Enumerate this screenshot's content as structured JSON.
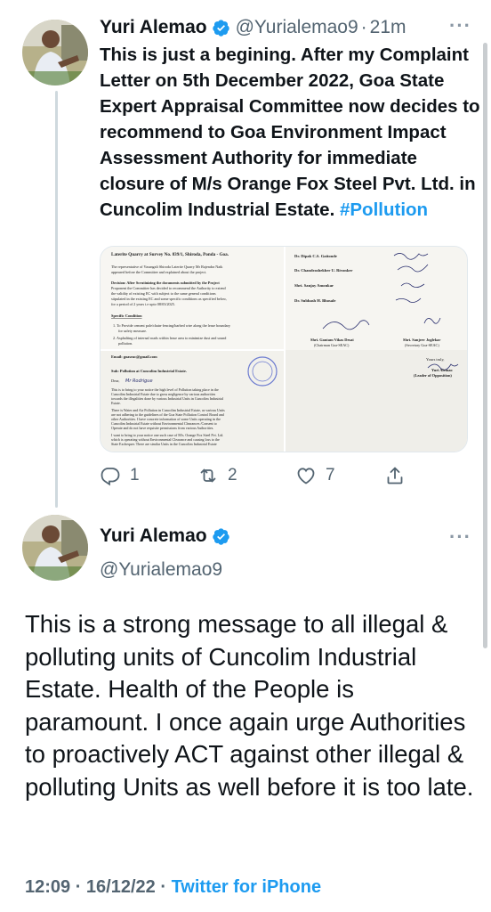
{
  "tweet1": {
    "author_name": "Yuri Alemao",
    "author_handle": "@Yurialemao9",
    "time_ago": "21m",
    "text": "This is just a begining. After my Complaint Letter on 5th December 2022, Goa State Expert Appraisal Committee now decides to recommend to Goa Environment Impact Assessment Authority for immediate closure of M/s Orange Fox Steel Pvt. Ltd. in Cuncolim Industrial Estate.",
    "hashtag": "#Pollution",
    "media": {
      "left_doc": {
        "heading": "Laterite Quarry at Survey No. 839/1, Shiroda, Ponda - Goa.",
        "para1": "The representative of Vasangali Shiroda Laterite Quarry Mr Rajendra Naik appeared before the Committee and explained about the project.",
        "decision": "Decision: After Scrutinizing the documents submitted by the Project Proponent the Committee has decided to recommend the Authority to extend the validity of existing EC with subject to the same general conditions stipulated in the existing EC and some specific conditions as specified below, for a period of 2 years i.e upto 08/03/2025.",
        "specific": "Specific Condition",
        "cond1": "1. To Provide cement pole/chain-fencing/barbed wire along the lease boundary for safety measure.",
        "cond2": "2. Asphalting of internal roads within lease area to minimize dust and sound pollution."
      },
      "right_doc": {
        "members": [
          "Dr. Dipak C.S. Gaitonde",
          "Dr. Chandrashekher U. Rivonker",
          "Shri. Sanjay Amonkar",
          "Dr. Subhash H. Bhosale"
        ],
        "chair": "Shri. Gautam Vikas Desai",
        "chair_role": "(Chairman Goa-SEAC)",
        "secretary": "Shri. Sanjeev Joglekar",
        "secretary_role": "(Secretary Goa-SEAC)"
      },
      "letter": {
        "email": "Email: goaseac@gmail.com",
        "subject": "Sub: Pollution at Cuncolim Industrial Estate.",
        "salutation": "Dear,",
        "body1": "This is to bring to your notice the high level of Pollution taking place in the Cuncolim Industrial Estate due to gross negligence by various authorities towards the illegalities done by various Industrial Units in Cuncolim Industrial Estate.",
        "body2": "There is Water and Air Pollution in Cuncolim Industrial Estate, as various Units are not adhering to the guidelines of the Goa State Pollution Control Board and other Authorities. I have concrete information of some Units operating in the Cuncolim Industrial Estate without Environmental Clearances /Consent to Operate and do not have requisite permissions from various Authorities.",
        "body3": "I want to bring to your notice one such case of M/s. Orange Fox Steel Pvt. Ltd. which is operating without Environmental Clearance and causing loss to the State Exchequer. There are similar Units in the Cuncolim Industrial Estate which are illegally operating and dump production beyond the capacity stated in",
        "yours": "Yours truly,",
        "signer": "Yuri Alemao",
        "signer_role": "(Leader of Opposition)"
      }
    },
    "actions": {
      "reply_count": "1",
      "retweet_count": "2",
      "like_count": "7"
    }
  },
  "tweet2": {
    "author_name": "Yuri Alemao",
    "author_handle": "@Yurialemao9",
    "text": "This is a strong message to all illegal & polluting units of Cuncolim Industrial Estate. Health of the People is paramount. I once again urge Authorities to proactively ACT against other illegal & polluting Units as well before it is too late.",
    "timestamp": "12:09 · 16/12/22 ·",
    "source": "Twitter for iPhone"
  },
  "icons": {
    "verified": "verified-badge-icon",
    "more": "more-options-icon",
    "reply": "reply-icon",
    "retweet": "retweet-icon",
    "like": "like-icon",
    "share": "share-icon"
  },
  "colors": {
    "accent": "#1d9bf0",
    "secondary_text": "#536471",
    "thread_line": "#cfd9de"
  }
}
